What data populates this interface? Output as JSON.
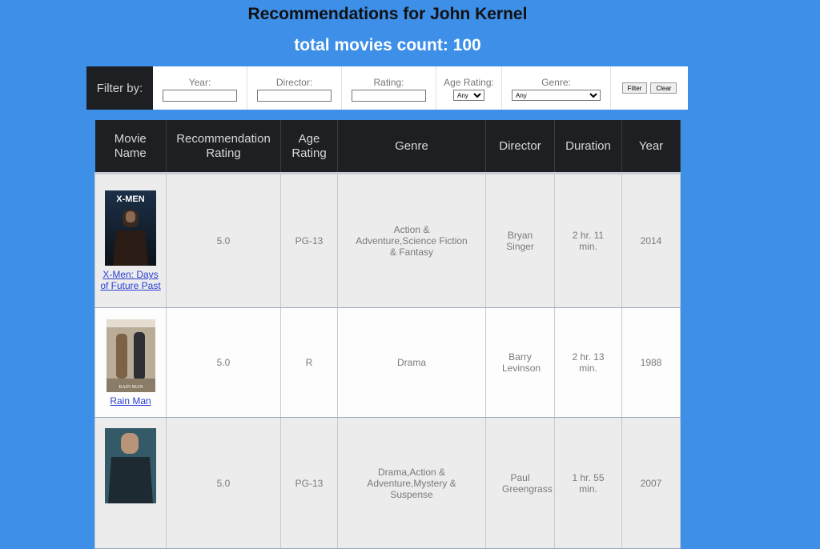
{
  "header": {
    "title": "Recommendations for John Kernel",
    "count": "total movies count: 100"
  },
  "filter": {
    "label": "Filter by:",
    "year_label": "Year:",
    "year_value": "",
    "director_label": "Director:",
    "director_value": "",
    "rating_label": "Rating:",
    "rating_value": "",
    "age_rating_label": "Age Rating:",
    "age_rating_selected": "Any",
    "genre_label": "Genre:",
    "genre_selected": "Any",
    "filter_button": "Filter",
    "clear_button": "Clear"
  },
  "table": {
    "columns": [
      "Movie Name",
      "Recommendation Rating",
      "Age Rating",
      "Genre",
      "Director",
      "Duration",
      "Year"
    ],
    "rows": [
      {
        "name": "X-Men: Days of Future Past",
        "rating": "5.0",
        "age": "PG-13",
        "genre": "Action & Adventure,Science Fiction & Fantasy",
        "director": "Bryan Singer",
        "duration": "2 hr. 11 min.",
        "year": "2014",
        "poster": "X-MEN"
      },
      {
        "name": "Rain Man",
        "rating": "5.0",
        "age": "R",
        "genre": "Drama",
        "director": "Barry Levinson",
        "duration": "2 hr. 13 min.",
        "year": "1988",
        "poster": "RAIN MAN"
      },
      {
        "name": "",
        "rating": "5.0",
        "age": "PG-13",
        "genre": "Drama,Action & Adventure,Mystery & Suspense",
        "director": "Paul Greengrass",
        "duration": "1 hr. 55 min.",
        "year": "2007",
        "poster": ""
      }
    ]
  }
}
